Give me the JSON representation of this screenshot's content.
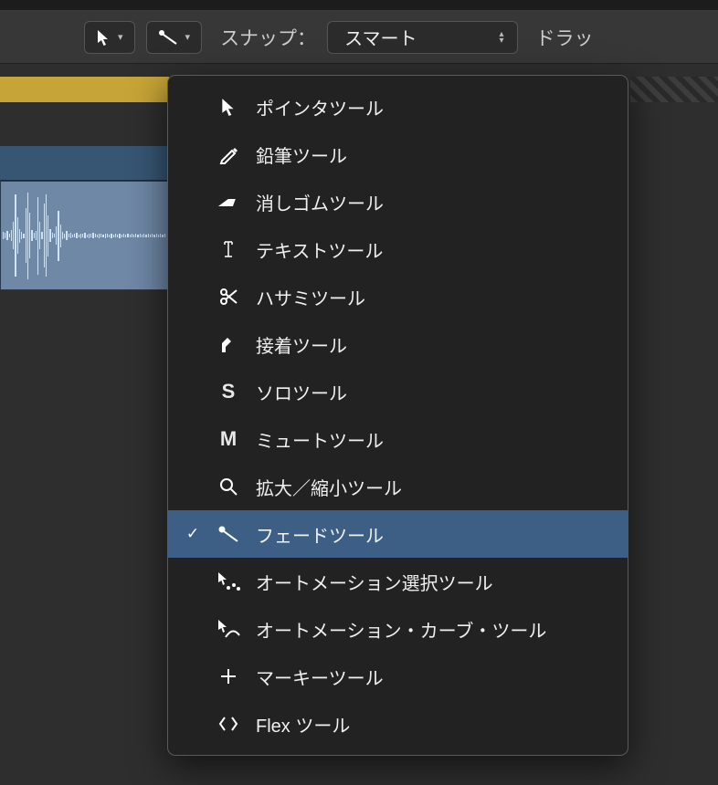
{
  "toolbar": {
    "snap_label": "スナップ：",
    "snap_value": "スマート",
    "drag_label": "ドラッ"
  },
  "menu": {
    "items": [
      {
        "icon": "pointer-icon",
        "label": "ポインタツール",
        "selected": false
      },
      {
        "icon": "pencil-icon",
        "label": "鉛筆ツール",
        "selected": false
      },
      {
        "icon": "eraser-icon",
        "label": "消しゴムツール",
        "selected": false
      },
      {
        "icon": "text-icon",
        "label": "テキストツール",
        "selected": false
      },
      {
        "icon": "scissors-icon",
        "label": "ハサミツール",
        "selected": false
      },
      {
        "icon": "glue-icon",
        "label": "接着ツール",
        "selected": false
      },
      {
        "icon": "solo-icon",
        "label": "ソロツール",
        "selected": false
      },
      {
        "icon": "mute-icon",
        "label": "ミュートツール",
        "selected": false
      },
      {
        "icon": "zoom-icon",
        "label": "拡大／縮小ツール",
        "selected": false
      },
      {
        "icon": "fade-icon",
        "label": "フェードツール",
        "selected": true
      },
      {
        "icon": "auto-select-icon",
        "label": "オートメーション選択ツール",
        "selected": false
      },
      {
        "icon": "auto-curve-icon",
        "label": "オートメーション・カーブ・ツール",
        "selected": false
      },
      {
        "icon": "marquee-icon",
        "label": "マーキーツール",
        "selected": false
      },
      {
        "icon": "flex-icon",
        "label": "Flex ツール",
        "selected": false
      }
    ]
  }
}
